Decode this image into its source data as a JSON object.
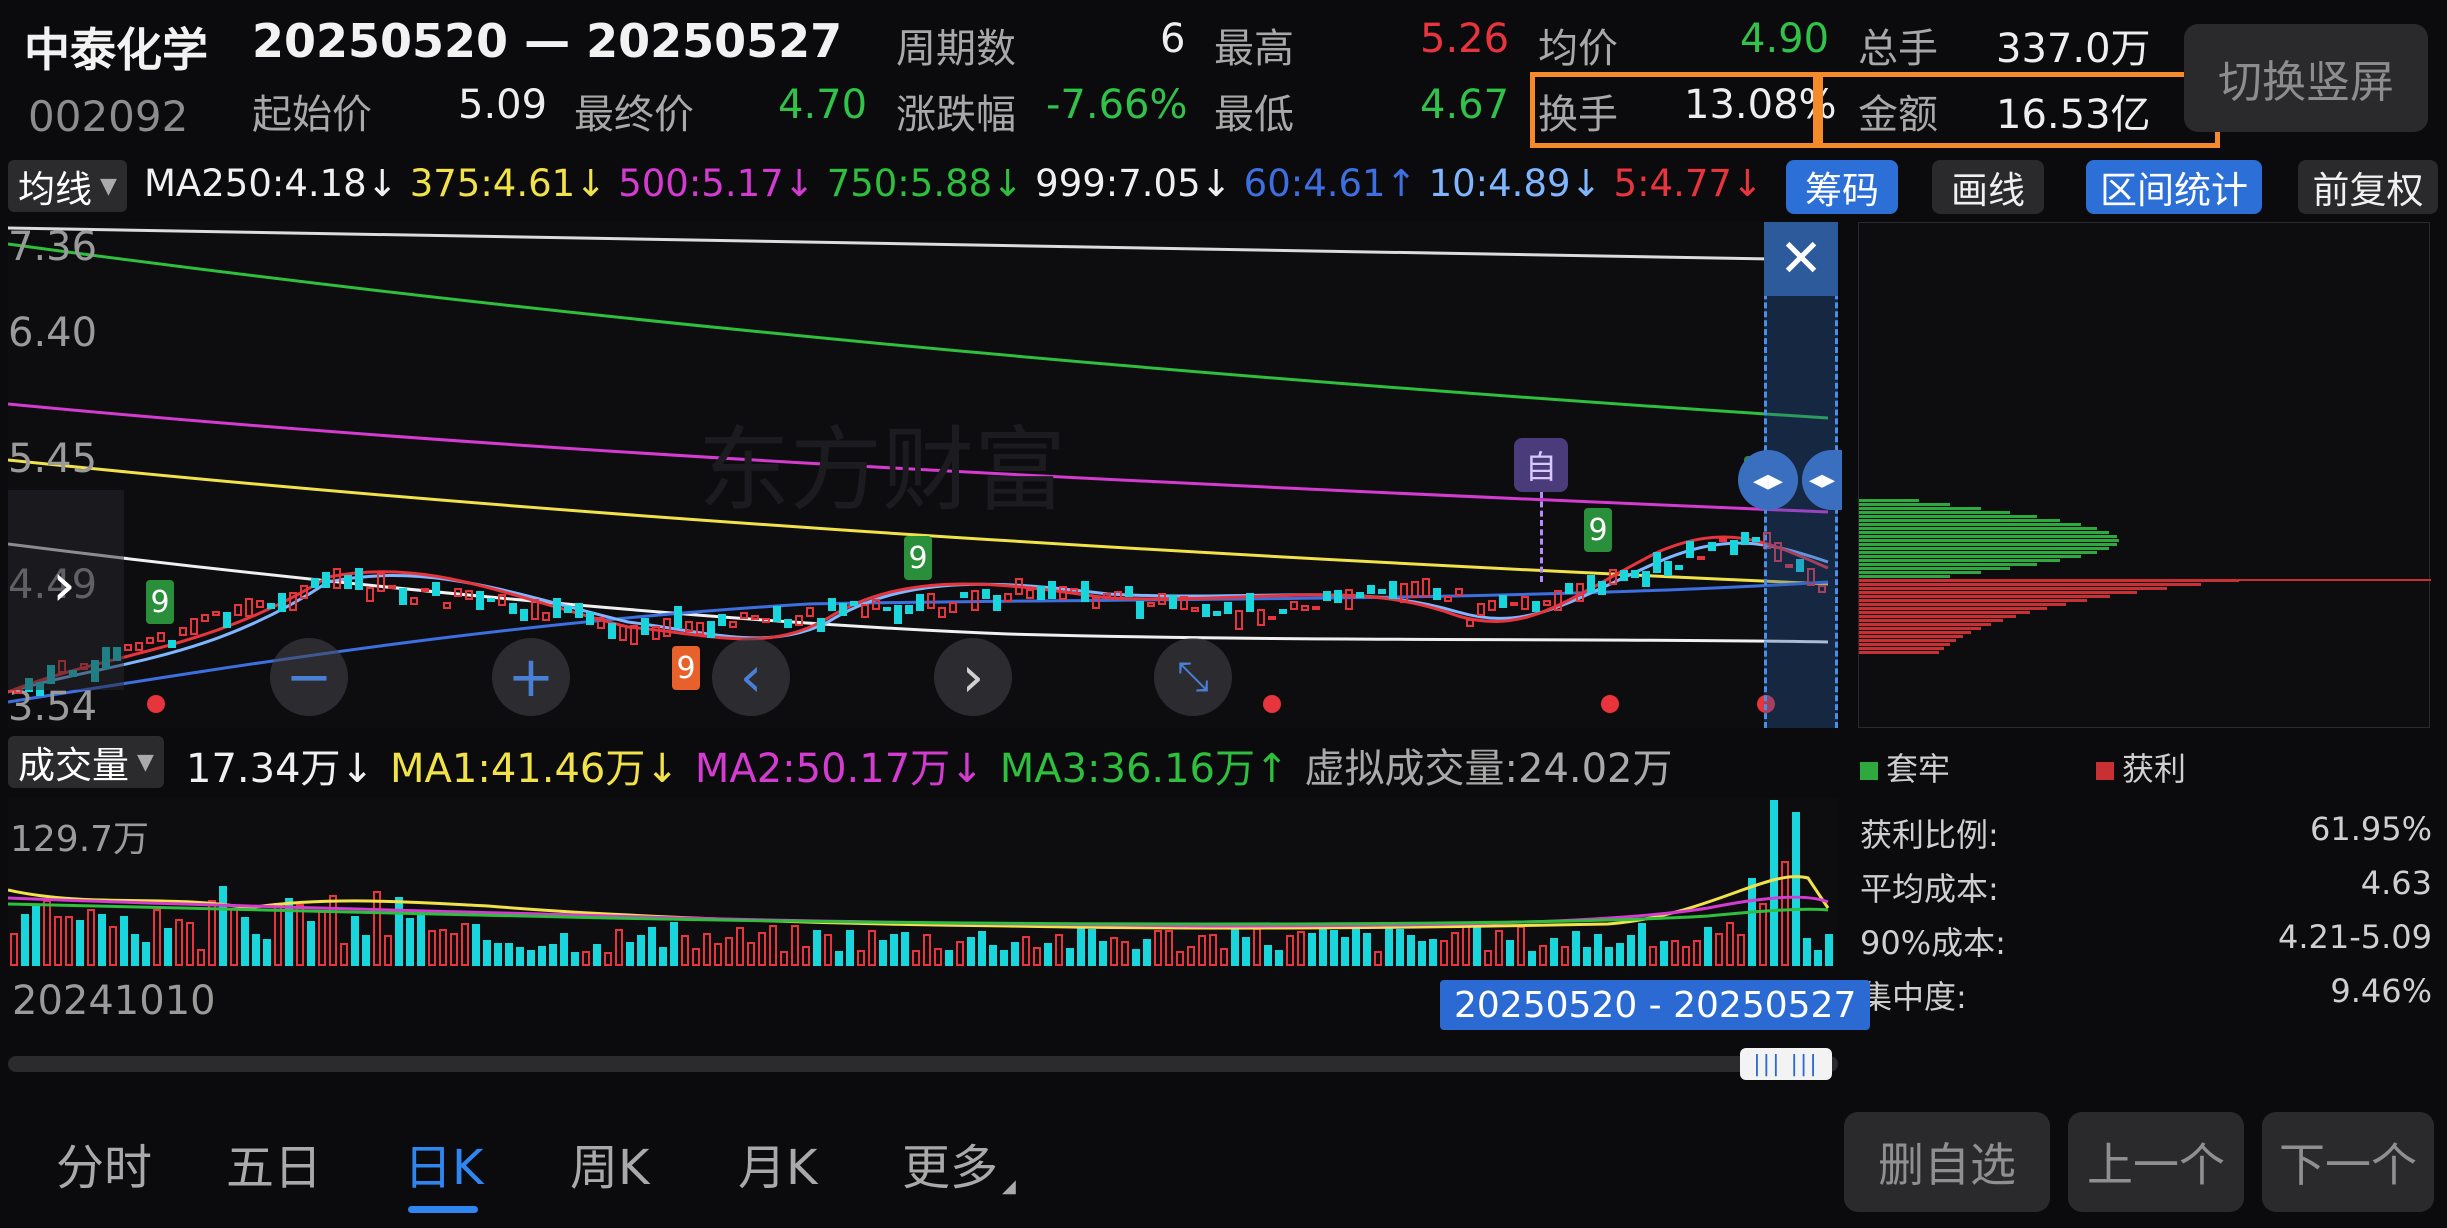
{
  "header": {
    "stock_name": "中泰化学",
    "date_range": "20250520 — 20250527",
    "stock_code": "002092",
    "stats": {
      "period_label": "周期数",
      "period_value": "6",
      "high_label": "最高",
      "high_value": "5.26",
      "avg_label": "均价",
      "avg_value": "4.90",
      "total_hands_label": "总手",
      "total_hands_value": "337.0万",
      "start_label": "起始价",
      "start_value": "5.09",
      "end_label": "最终价",
      "end_value": "4.70",
      "change_label": "涨跌幅",
      "change_value": "-7.66%",
      "low_label": "最低",
      "low_value": "4.67",
      "turnover_label": "换手",
      "turnover_value": "13.08%",
      "amount_label": "金额",
      "amount_value": "16.53亿"
    },
    "switch_button": "切换竖屏"
  },
  "ma_bar": {
    "dropdown": "均线",
    "items": [
      {
        "text": "MA250:4.18↓",
        "color": "#f0f0f0"
      },
      {
        "text": "375:4.61↓",
        "color": "#f2e24a"
      },
      {
        "text": "500:5.17↓",
        "color": "#d43bd0"
      },
      {
        "text": "750:5.88↓",
        "color": "#2fbf3e"
      },
      {
        "text": "999:7.05↓",
        "color": "#f0f0f0"
      },
      {
        "text": "60:4.61↑",
        "color": "#3d6fe0"
      },
      {
        "text": "10:4.89↓",
        "color": "#7fb6ff"
      },
      {
        "text": "5:4.77↓",
        "color": "#e8343c"
      }
    ],
    "buttons": {
      "chips": "筹码",
      "draw": "画线",
      "interval": "区间统计",
      "adjust": "前复权"
    }
  },
  "price_axis": [
    "7.36",
    "6.40",
    "5.45",
    "4.49",
    "3.54"
  ],
  "watermark": "东方财富",
  "self_marker": "自",
  "nine_markers": [
    "9",
    "9",
    "9",
    "9",
    "9"
  ],
  "volume_bar": {
    "dropdown": "成交量",
    "items": [
      {
        "text": "17.34万↓",
        "color": "#f0f0f0"
      },
      {
        "text": "MA1:41.46万↓",
        "color": "#f2e24a"
      },
      {
        "text": "MA2:50.17万↓",
        "color": "#d43bd0"
      },
      {
        "text": "MA3:36.16万↑",
        "color": "#2fbf3e"
      },
      {
        "text": "虚拟成交量:24.02万",
        "color": "#a9a9a9"
      }
    ],
    "vol_max": "129.7万"
  },
  "x_axis": {
    "start_date": "20241010",
    "selection": "20250520 - 20250527"
  },
  "chips_panel": {
    "legend_trapped": "套牢",
    "legend_profit": "获利",
    "rows": [
      {
        "label": "获利比例:",
        "value": "61.95%"
      },
      {
        "label": "平均成本:",
        "value": "4.63"
      },
      {
        "label": "90%成本:",
        "value": "4.21-5.09"
      },
      {
        "label": "集中度:",
        "value": "9.46%"
      }
    ]
  },
  "bottom_tabs": [
    "分时",
    "五日",
    "日K",
    "周K",
    "月K",
    "更多"
  ],
  "active_tab": "日K",
  "bottom_buttons": {
    "remove": "删自选",
    "prev": "上一个",
    "next": "下一个"
  },
  "colors": {
    "up": "#e8343c",
    "down": "#18d6dc",
    "accent": "#2f86f0",
    "highlight": "#f58a2a"
  }
}
